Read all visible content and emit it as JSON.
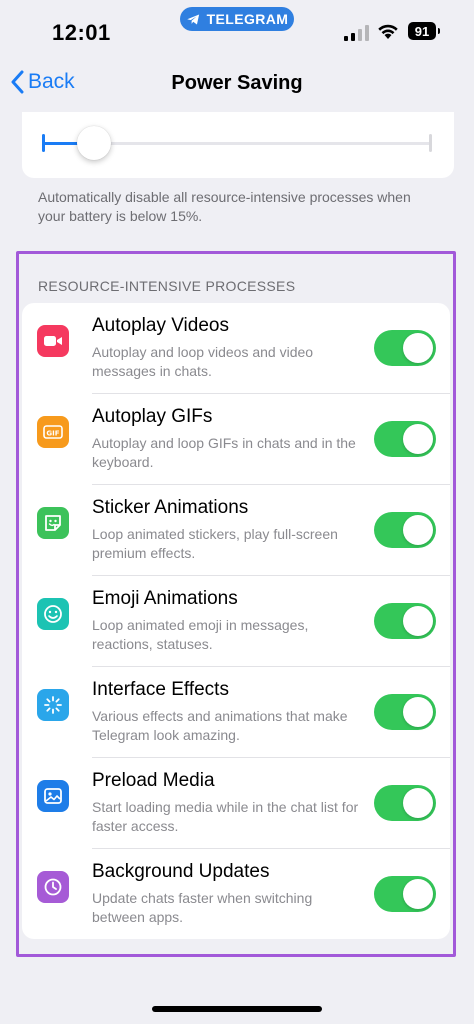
{
  "status_bar": {
    "time": "12:01",
    "app_pill": "TELEGRAM",
    "battery": "91"
  },
  "nav": {
    "back_label": "Back",
    "title": "Power Saving"
  },
  "slider": {
    "value_fraction": 0.13,
    "accent": "#1a7cf5"
  },
  "footnote": "Automatically disable all resource-intensive processes when your battery is below 15%.",
  "section": {
    "header": "RESOURCE-INTENSIVE PROCESSES",
    "highlight_color": "#a259d9",
    "items": [
      {
        "title": "Autoplay Videos",
        "desc": "Autoplay and loop videos and video messages in chats.",
        "icon": "video-camera-icon",
        "icon_color": "#f5395f",
        "enabled": true
      },
      {
        "title": "Autoplay GIFs",
        "desc": "Autoplay and loop GIFs in chats and in the keyboard.",
        "icon": "gif-icon",
        "icon_color": "#f79a1c",
        "enabled": true
      },
      {
        "title": "Sticker Animations",
        "desc": "Loop animated stickers, play full-screen premium effects.",
        "icon": "sticker-icon",
        "icon_color": "#3cc25a",
        "enabled": true
      },
      {
        "title": "Emoji Animations",
        "desc": "Loop animated emoji in messages, reactions, statuses.",
        "icon": "emoji-icon",
        "icon_color": "#1cc3b3",
        "enabled": true
      },
      {
        "title": "Interface Effects",
        "desc": "Various effects and animations that make Telegram look amazing.",
        "icon": "sparkle-icon",
        "icon_color": "#2aa6ea",
        "enabled": true
      },
      {
        "title": "Preload Media",
        "desc": "Start loading media while in the chat list for faster access.",
        "icon": "image-icon",
        "icon_color": "#1e7de8",
        "enabled": true
      },
      {
        "title": "Background Updates",
        "desc": "Update chats faster when switching between apps.",
        "icon": "clock-icon",
        "icon_color": "#a65bd6",
        "enabled": true
      }
    ]
  },
  "colors": {
    "toggle_on": "#34c759",
    "background": "#efeff4"
  }
}
